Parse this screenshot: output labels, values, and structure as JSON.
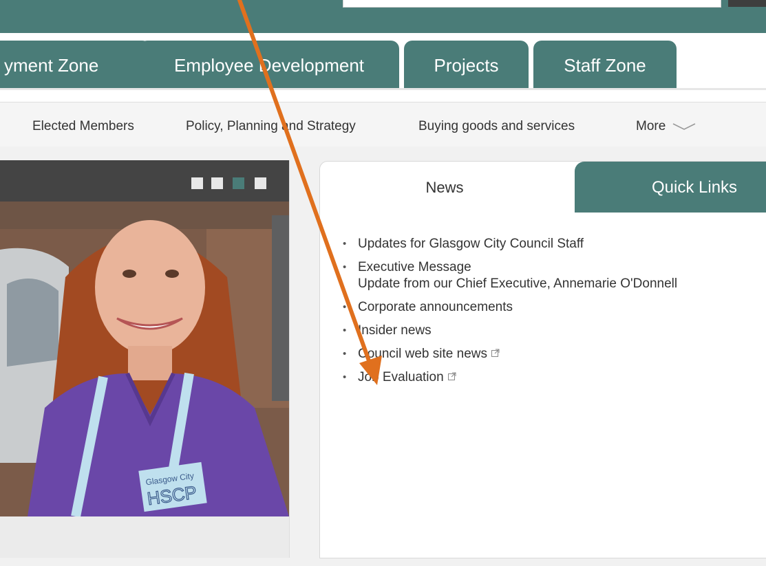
{
  "main_tabs": [
    {
      "label": "yment Zone"
    },
    {
      "label": "Employee Development"
    },
    {
      "label": "Projects"
    },
    {
      "label": "Staff Zone"
    }
  ],
  "sub_nav": [
    {
      "label": "Elected Members"
    },
    {
      "label": "Policy, Planning and Strategy"
    },
    {
      "label": "Buying goods and services"
    },
    {
      "label": "More"
    }
  ],
  "carousel": {
    "dots": 4,
    "active_dot": 3,
    "badge_line1": "Glasgow City",
    "badge_line2": "HSCP"
  },
  "panel": {
    "tabs": [
      {
        "label": "News",
        "active": true
      },
      {
        "label": "Quick Links",
        "active": false
      }
    ],
    "news_items": [
      {
        "title": "Updates for Glasgow City Council Staff",
        "subtitle": "",
        "external": false
      },
      {
        "title": "Executive Message",
        "subtitle": "Update from our Chief Executive, Annemarie O'Donnell",
        "external": false
      },
      {
        "title": "Corporate announcements",
        "subtitle": "",
        "external": false
      },
      {
        "title": "Insider news",
        "subtitle": "",
        "external": false
      },
      {
        "title": "Council web site news",
        "subtitle": "",
        "external": true
      },
      {
        "title": "Job Evaluation",
        "subtitle": "",
        "external": true
      }
    ]
  },
  "colors": {
    "brand_teal": "#4a7c78",
    "annotation_orange": "#e0701e"
  },
  "icons": [
    "chevron-down-icon",
    "external-link-icon",
    "annotation-arrow-icon"
  ]
}
